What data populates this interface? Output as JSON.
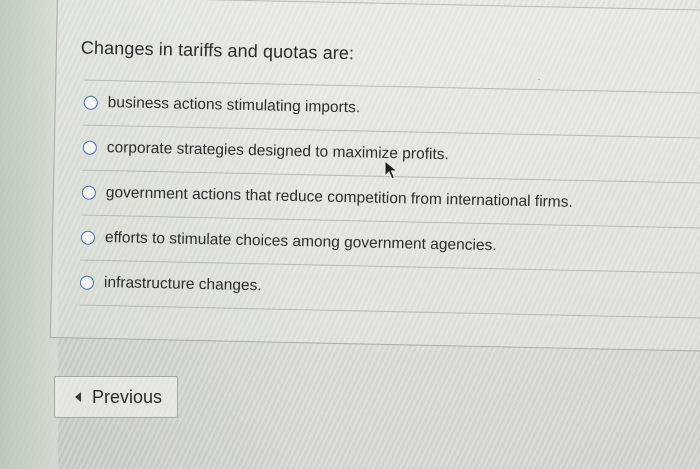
{
  "question": {
    "title": "Changes in tariffs and quotas are:"
  },
  "options": [
    {
      "label": "business actions stimulating imports."
    },
    {
      "label": "corporate strategies designed to maximize profits."
    },
    {
      "label": "government actions that reduce competition from international firms."
    },
    {
      "label": "efforts to stimulate choices among government agencies."
    },
    {
      "label": "infrastructure changes."
    }
  ],
  "navigation": {
    "previous_label": "Previous"
  },
  "colors": {
    "radio_border": "#4b6ea8",
    "text": "#2c2d2c"
  }
}
